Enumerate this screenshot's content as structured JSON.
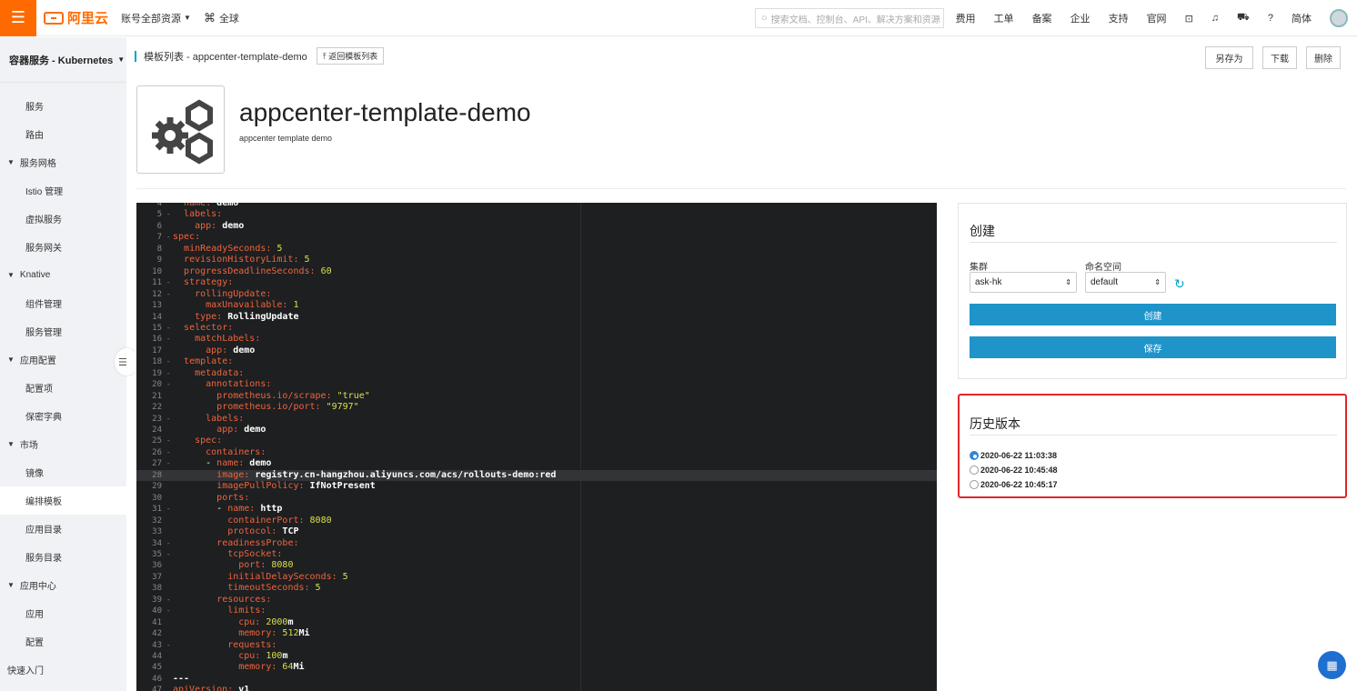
{
  "topbar": {
    "brand": "阿里云",
    "account_scope": "账号全部资源",
    "region": "全球",
    "search_placeholder": "搜索文档、控制台、API、解决方案和资源",
    "nav": [
      "费用",
      "工单",
      "备案",
      "企业",
      "支持",
      "官网"
    ],
    "lang": "简体"
  },
  "sidebar": {
    "title": "容器服务 - Kubernetes",
    "items": [
      {
        "type": "item",
        "label": "服务"
      },
      {
        "type": "item",
        "label": "路由"
      },
      {
        "type": "group",
        "label": "服务网格"
      },
      {
        "type": "item",
        "label": "Istio 管理"
      },
      {
        "type": "item",
        "label": "虚拟服务"
      },
      {
        "type": "item",
        "label": "服务网关"
      },
      {
        "type": "group",
        "label": "Knative"
      },
      {
        "type": "item",
        "label": "组件管理"
      },
      {
        "type": "item",
        "label": "服务管理"
      },
      {
        "type": "group",
        "label": "应用配置"
      },
      {
        "type": "item",
        "label": "配置项"
      },
      {
        "type": "item",
        "label": "保密字典"
      },
      {
        "type": "group",
        "label": "市场"
      },
      {
        "type": "item",
        "label": "镜像"
      },
      {
        "type": "item",
        "label": "编排模板",
        "active": true
      },
      {
        "type": "item",
        "label": "应用目录"
      },
      {
        "type": "item",
        "label": "服务目录"
      },
      {
        "type": "group",
        "label": "应用中心"
      },
      {
        "type": "item",
        "label": "应用"
      },
      {
        "type": "item",
        "label": "配置"
      },
      {
        "type": "plain",
        "label": "快速入门"
      }
    ]
  },
  "header": {
    "breadcrumb": "模板列表 - appcenter-template-demo",
    "back_label": "返回模板列表",
    "save_as": "另存为",
    "download": "下载",
    "delete": "删除"
  },
  "app": {
    "title": "appcenter-template-demo",
    "description": "appcenter template demo"
  },
  "editor": {
    "highlight_line": 28,
    "lines": [
      {
        "n": 4,
        "i": 2,
        "k": "name:",
        "v": " demo"
      },
      {
        "n": 5,
        "i": 2,
        "k": "labels:",
        "v": "",
        "f": true
      },
      {
        "n": 6,
        "i": 4,
        "k": "app:",
        "v": " demo"
      },
      {
        "n": 7,
        "i": 0,
        "k": "spec:",
        "v": "",
        "f": true
      },
      {
        "n": 8,
        "i": 2,
        "k": "minReadySeconds:",
        "num": " 5"
      },
      {
        "n": 9,
        "i": 2,
        "k": "revisionHistoryLimit:",
        "num": " 5"
      },
      {
        "n": 10,
        "i": 2,
        "k": "progressDeadlineSeconds:",
        "num": " 60"
      },
      {
        "n": 11,
        "i": 2,
        "k": "strategy:",
        "v": "",
        "f": true
      },
      {
        "n": 12,
        "i": 4,
        "k": "rollingUpdate:",
        "v": "",
        "f": true
      },
      {
        "n": 13,
        "i": 6,
        "k": "maxUnavailable:",
        "num": " 1"
      },
      {
        "n": 14,
        "i": 4,
        "k": "type:",
        "v": " RollingUpdate"
      },
      {
        "n": 15,
        "i": 2,
        "k": "selector:",
        "v": "",
        "f": true
      },
      {
        "n": 16,
        "i": 4,
        "k": "matchLabels:",
        "v": "",
        "f": true
      },
      {
        "n": 17,
        "i": 6,
        "k": "app:",
        "v": " demo"
      },
      {
        "n": 18,
        "i": 2,
        "k": "template:",
        "v": "",
        "f": true
      },
      {
        "n": 19,
        "i": 4,
        "k": "metadata:",
        "v": "",
        "f": true
      },
      {
        "n": 20,
        "i": 6,
        "k": "annotations:",
        "v": "",
        "f": true
      },
      {
        "n": 21,
        "i": 8,
        "k": "prometheus.io/scrape:",
        "str": " \"true\""
      },
      {
        "n": 22,
        "i": 8,
        "k": "prometheus.io/port:",
        "str": " \"9797\""
      },
      {
        "n": 23,
        "i": 6,
        "k": "labels:",
        "v": "",
        "f": true
      },
      {
        "n": 24,
        "i": 8,
        "k": "app:",
        "v": " demo"
      },
      {
        "n": 25,
        "i": 4,
        "k": "spec:",
        "v": "",
        "f": true
      },
      {
        "n": 26,
        "i": 6,
        "k": "containers:",
        "v": "",
        "f": true
      },
      {
        "n": 27,
        "i": 6,
        "p": "- ",
        "k": "name:",
        "v": " demo",
        "f": true
      },
      {
        "n": 28,
        "i": 8,
        "k": "image:",
        "v": " registry.cn-hangzhou.aliyuncs.com/acs/rollouts-demo:red"
      },
      {
        "n": 29,
        "i": 8,
        "k": "imagePullPolicy:",
        "v": " IfNotPresent"
      },
      {
        "n": 30,
        "i": 8,
        "k": "ports:",
        "v": ""
      },
      {
        "n": 31,
        "i": 8,
        "p": "- ",
        "k": "name:",
        "v": " http",
        "f": true
      },
      {
        "n": 32,
        "i": 10,
        "k": "containerPort:",
        "num": " 8080"
      },
      {
        "n": 33,
        "i": 10,
        "k": "protocol:",
        "v": " TCP"
      },
      {
        "n": 34,
        "i": 8,
        "k": "readinessProbe:",
        "v": "",
        "f": true
      },
      {
        "n": 35,
        "i": 10,
        "k": "tcpSocket:",
        "v": "",
        "f": true
      },
      {
        "n": 36,
        "i": 12,
        "k": "port:",
        "num": " 8080"
      },
      {
        "n": 37,
        "i": 10,
        "k": "initialDelaySeconds:",
        "num": " 5"
      },
      {
        "n": 38,
        "i": 10,
        "k": "timeoutSeconds:",
        "num": " 5"
      },
      {
        "n": 39,
        "i": 8,
        "k": "resources:",
        "v": "",
        "f": true
      },
      {
        "n": 40,
        "i": 10,
        "k": "limits:",
        "v": "",
        "f": true
      },
      {
        "n": 41,
        "i": 12,
        "k": "cpu:",
        "num": " 2000",
        "v2": "m"
      },
      {
        "n": 42,
        "i": 12,
        "k": "memory:",
        "num": " 512",
        "v2": "Mi"
      },
      {
        "n": 43,
        "i": 10,
        "k": "requests:",
        "v": "",
        "f": true
      },
      {
        "n": 44,
        "i": 12,
        "k": "cpu:",
        "num": " 100",
        "v2": "m"
      },
      {
        "n": 45,
        "i": 12,
        "k": "memory:",
        "num": " 64",
        "v2": "Mi"
      },
      {
        "n": 46,
        "i": 0,
        "k": "",
        "v": "---"
      },
      {
        "n": 47,
        "i": 0,
        "k": "apiVersion:",
        "v": " v1"
      }
    ]
  },
  "create_panel": {
    "title": "创建",
    "cluster_label": "集群",
    "cluster_value": "ask-hk",
    "namespace_label": "命名空间",
    "namespace_value": "default",
    "create_button": "创建",
    "save_button": "保存"
  },
  "history": {
    "title": "历史版本",
    "versions": [
      {
        "label": "2020-06-22 11:03:38",
        "selected": true
      },
      {
        "label": "2020-06-22 10:45:48",
        "selected": false
      },
      {
        "label": "2020-06-22 10:45:17",
        "selected": false
      }
    ]
  },
  "colors": {
    "brand": "#ff6a00",
    "primary": "#1f94c9",
    "highlight_border": "#e0262b"
  }
}
